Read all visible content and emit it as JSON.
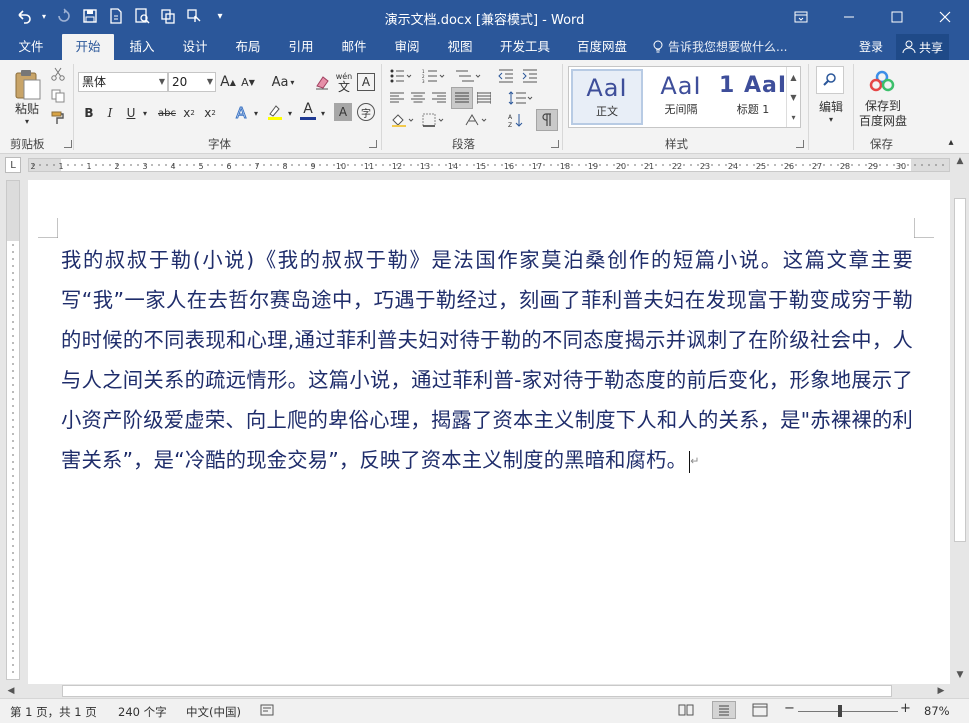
{
  "window": {
    "title": "演示文档.docx [兼容模式] - Word"
  },
  "tabs": [
    {
      "label": "文件"
    },
    {
      "label": "开始"
    },
    {
      "label": "插入"
    },
    {
      "label": "设计"
    },
    {
      "label": "布局"
    },
    {
      "label": "引用"
    },
    {
      "label": "邮件"
    },
    {
      "label": "审阅"
    },
    {
      "label": "视图"
    },
    {
      "label": "开发工具"
    },
    {
      "label": "百度网盘"
    }
  ],
  "tell_me": "告诉我您想要做什么...",
  "account": {
    "login": "登录",
    "share": "共享"
  },
  "ribbon": {
    "clipboard": {
      "paste": "粘贴",
      "label": "剪贴板"
    },
    "font": {
      "name": "黑体",
      "size": "20",
      "grow": "A",
      "shrink": "A",
      "case": "Aa",
      "bold": "B",
      "italic": "I",
      "underline": "U",
      "strike": "abc",
      "sub": "x",
      "sub_mark": "2",
      "sup": "x",
      "sup_mark": "2",
      "phonetic_top": "wén",
      "phonetic_bottom": "文",
      "border_char": "A",
      "font_color_char": "A",
      "shading_char": "A",
      "circle_char": "字",
      "label": "字体"
    },
    "paragraph": {
      "label": "段落"
    },
    "styles": {
      "items": [
        {
          "sample": "AaI",
          "name": "正文"
        },
        {
          "sample": "AaI",
          "name": "无间隔"
        },
        {
          "sample": "1 AaI",
          "name": "标题 1"
        }
      ],
      "label": "样式"
    },
    "editing": {
      "label": "编辑"
    },
    "save": {
      "line1": "保存到",
      "line2": "百度网盘",
      "label": "保存"
    }
  },
  "ruler": {
    "numbers": [
      "2",
      "1",
      "1",
      "2",
      "3",
      "4",
      "5",
      "6",
      "7",
      "8",
      "9",
      "10",
      "11",
      "12",
      "13",
      "14",
      "15",
      "16",
      "17",
      "18",
      "19",
      "20",
      "21",
      "22",
      "23",
      "24",
      "25",
      "26",
      "27",
      "28",
      "29",
      "30",
      "31",
      "32",
      "33",
      "34",
      "35",
      "36",
      "37",
      "38",
      "39",
      "40"
    ]
  },
  "document": {
    "paragraph": "我的叔叔于勒(小说)《我的叔叔于勒》是法国作家莫泊桑创作的短篇小说。这篇文章主要写“我”一家人在去哲尔赛岛途中，巧遇于勒经过，刻画了菲利普夫妇在发现富于勒变成穷于勒的时候的不同表现和心理,通过菲利普夫妇对待于勒的不同态度揭示并讽刺了在阶级社会中，人与人之间关系的疏远情形。这篇小说，通过菲利普-家对待于勒态度的前后变化，形象地展示了小资产阶级爱虚荣、向上爬的卑俗心理，揭露了资本主义制度下人和人的关系，是\"赤裸裸的利害关系”，是“冷酷的现金交易”，反映了资本主义制度的黑暗和腐朽。"
  },
  "status": {
    "page": "第 1 页，共 1 页",
    "words": "240 个字",
    "language": "中文(中国)",
    "zoom": "87%"
  },
  "colors": {
    "brand": "#2b579a",
    "text": "#1f2d6b"
  }
}
